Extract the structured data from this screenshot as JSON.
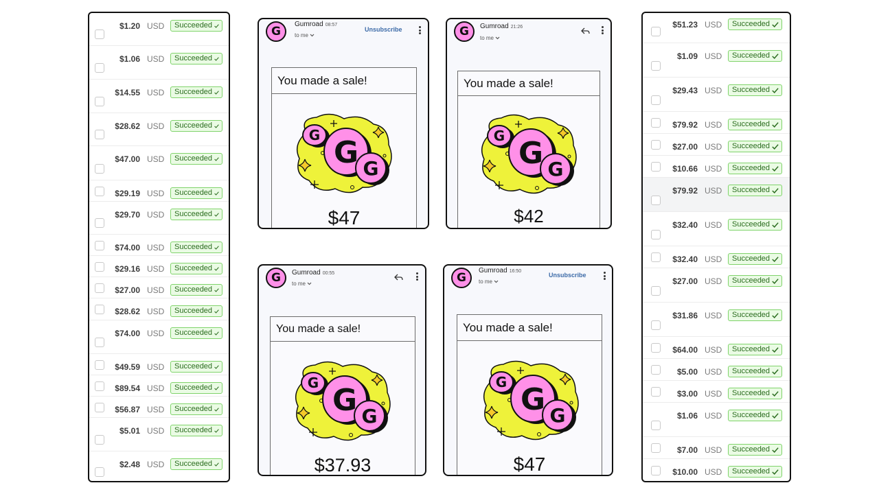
{
  "left_payments": [
    {
      "amount": "$1.20",
      "currency": "USD",
      "status": "Succeeded"
    },
    {
      "amount": "$1.06",
      "currency": "USD",
      "status": "Succeeded"
    },
    {
      "amount": "$14.55",
      "currency": "USD",
      "status": "Succeeded"
    },
    {
      "amount": "$28.62",
      "currency": "USD",
      "status": "Succeeded"
    },
    {
      "amount": "$47.00",
      "currency": "USD",
      "status": "Succeeded"
    },
    {
      "amount": "$29.19",
      "currency": "USD",
      "status": "Succeeded"
    },
    {
      "amount": "$29.70",
      "currency": "USD",
      "status": "Succeeded"
    },
    {
      "amount": "$74.00",
      "currency": "USD",
      "status": "Succeeded"
    },
    {
      "amount": "$29.16",
      "currency": "USD",
      "status": "Succeeded"
    },
    {
      "amount": "$27.00",
      "currency": "USD",
      "status": "Succeeded"
    },
    {
      "amount": "$28.62",
      "currency": "USD",
      "status": "Succeeded"
    },
    {
      "amount": "$74.00",
      "currency": "USD",
      "status": "Succeeded"
    },
    {
      "amount": "$49.59",
      "currency": "USD",
      "status": "Succeeded"
    },
    {
      "amount": "$89.54",
      "currency": "USD",
      "status": "Succeeded"
    },
    {
      "amount": "$56.87",
      "currency": "USD",
      "status": "Succeeded"
    },
    {
      "amount": "$5.01",
      "currency": "USD",
      "status": "Succeeded"
    },
    {
      "amount": "$2.48",
      "currency": "USD",
      "status": "Succeeded"
    }
  ],
  "right_payments": [
    {
      "amount": "$51.23",
      "currency": "USD",
      "status": "Succeeded"
    },
    {
      "amount": "$1.09",
      "currency": "USD",
      "status": "Succeeded"
    },
    {
      "amount": "$29.43",
      "currency": "USD",
      "status": "Succeeded"
    },
    {
      "amount": "$79.92",
      "currency": "USD",
      "status": "Succeeded"
    },
    {
      "amount": "$27.00",
      "currency": "USD",
      "status": "Succeeded"
    },
    {
      "amount": "$10.66",
      "currency": "USD",
      "status": "Succeeded"
    },
    {
      "amount": "$79.92",
      "currency": "USD",
      "status": "Succeeded"
    },
    {
      "amount": "$32.40",
      "currency": "USD",
      "status": "Succeeded"
    },
    {
      "amount": "$32.40",
      "currency": "USD",
      "status": "Succeeded"
    },
    {
      "amount": "$27.00",
      "currency": "USD",
      "status": "Succeeded"
    },
    {
      "amount": "$31.86",
      "currency": "USD",
      "status": "Succeeded"
    },
    {
      "amount": "$64.00",
      "currency": "USD",
      "status": "Succeeded"
    },
    {
      "amount": "$5.00",
      "currency": "USD",
      "status": "Succeeded"
    },
    {
      "amount": "$3.00",
      "currency": "USD",
      "status": "Succeeded"
    },
    {
      "amount": "$1.06",
      "currency": "USD",
      "status": "Succeeded"
    },
    {
      "amount": "$7.00",
      "currency": "USD",
      "status": "Succeeded"
    },
    {
      "amount": "$10.00",
      "currency": "USD",
      "status": "Succeeded"
    }
  ],
  "emails": [
    {
      "sender": "Gumroad",
      "time": "08:57",
      "recipient": "to me",
      "action": "Unsubscribe",
      "heading": "You made a sale!",
      "amount": "$47"
    },
    {
      "sender": "Gumroad",
      "time": "21:26",
      "recipient": "to me",
      "action": "",
      "heading": "You made a sale!",
      "amount": "$42"
    },
    {
      "sender": "Gumroad",
      "time": "00:55",
      "recipient": "to me",
      "action": "",
      "heading": "You made a sale!",
      "amount": "$37.93"
    },
    {
      "sender": "Gumroad",
      "time": "16:50",
      "recipient": "to me",
      "action": "Unsubscribe",
      "heading": "You made a sale!",
      "amount": "$47"
    }
  ],
  "avatar_letter": "G",
  "icons": {
    "reply": "reply-icon",
    "more": "more-vert-icon",
    "check": "check-icon",
    "expand": "chevron-down-icon"
  },
  "colors": {
    "gumroad_pink": "#ff90e8",
    "sticker_yellow": "#eef23a",
    "success_green": "#7fd36a",
    "link_blue": "#3d6ba8"
  }
}
